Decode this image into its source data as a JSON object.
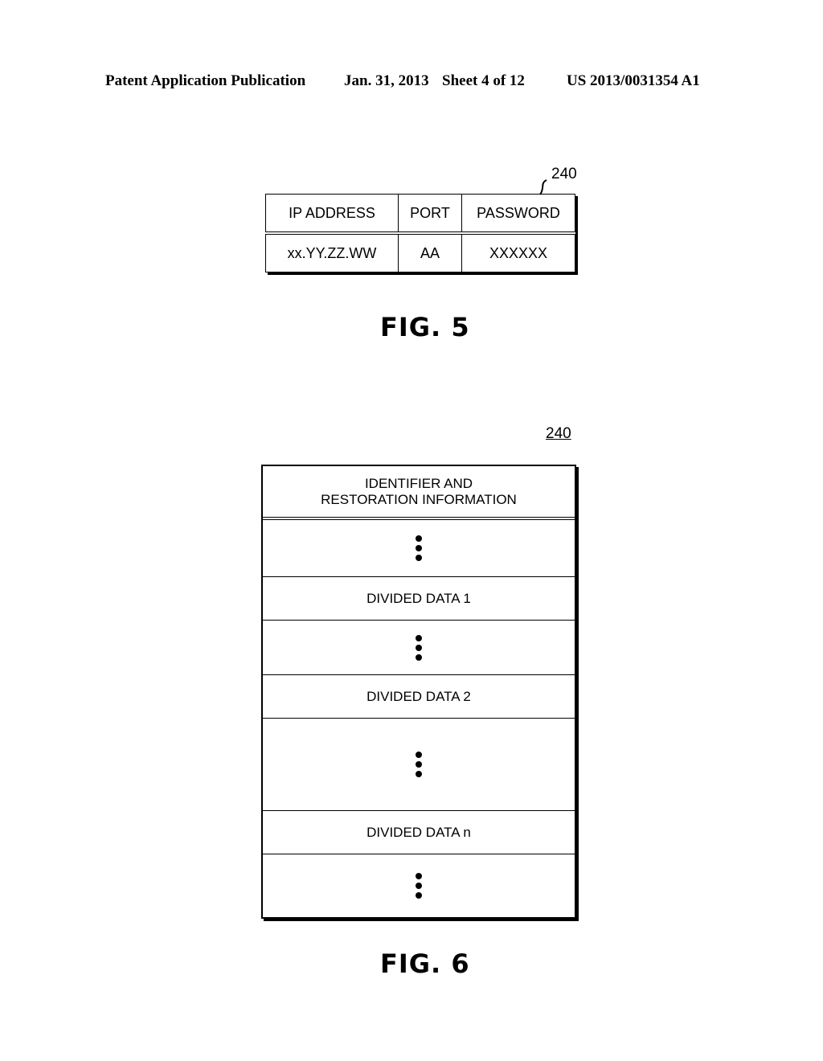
{
  "header": {
    "publication": "Patent Application Publication",
    "date": "Jan. 31, 2013",
    "sheet": "Sheet 4 of 12",
    "number": "US 2013/0031354 A1"
  },
  "fig5": {
    "ref": "240",
    "columns": [
      "IP ADDRESS",
      "PORT",
      "PASSWORD"
    ],
    "row": [
      "xx.YY.ZZ.WW",
      "AA",
      "XXXXXX"
    ],
    "label": "FIG. 5"
  },
  "fig6": {
    "ref": "240",
    "header_line1": "IDENTIFIER AND",
    "header_line2": "RESTORATION INFORMATION",
    "rows": [
      "DIVIDED DATA 1",
      "DIVIDED DATA 2",
      "DIVIDED DATA n"
    ],
    "label": "FIG. 6"
  }
}
